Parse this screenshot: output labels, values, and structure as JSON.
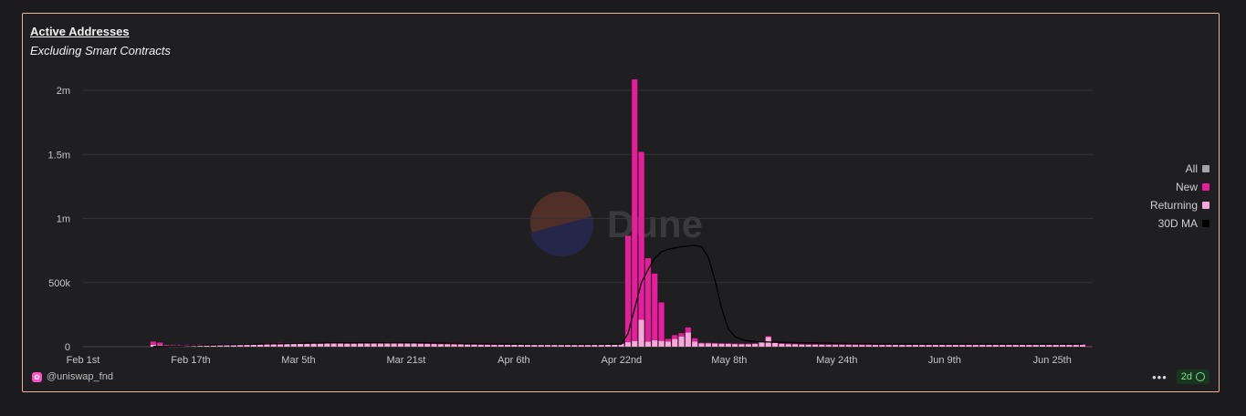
{
  "header": {
    "title": "Active Addresses",
    "subtitle": "Excluding Smart Contracts"
  },
  "watermark": {
    "text": "Dune"
  },
  "footer": {
    "author": "@uniswap_fnd",
    "more_icon": "more-dots-icon",
    "freshness": "2d",
    "freshness_icon": "check-circle-icon"
  },
  "colors": {
    "new": "#e81d9c",
    "returning": "#f7a8d8",
    "all": "#a3a3a3",
    "ma": "#000000",
    "grid": "#343437",
    "axis_text": "#c7c7c7"
  },
  "chart_data": {
    "type": "bar",
    "stacked": true,
    "title": "Active Addresses",
    "subtitle": "Excluding Smart Contracts",
    "x_tick_labels": [
      "Feb 1st",
      "Feb 17th",
      "Mar 5th",
      "Mar 21st",
      "Apr 6th",
      "Apr 22nd",
      "May 8th",
      "May 24th",
      "Jun 9th",
      "Jun 25th"
    ],
    "y_tick_labels": [
      "0",
      "500k",
      "1m",
      "1.5m",
      "2m"
    ],
    "y_ticks": [
      0,
      500000,
      1000000,
      1500000,
      2000000
    ],
    "ylim": [
      0,
      2000000
    ],
    "x_start_day": 0,
    "x_end_day": 150,
    "legend": {
      "position": "right",
      "entries": [
        {
          "name": "All",
          "color": "#a3a3a3"
        },
        {
          "name": "New",
          "color": "#e81d9c"
        },
        {
          "name": "Returning",
          "color": "#f7a8d8"
        },
        {
          "name": "30D MA",
          "color": "#000000"
        }
      ]
    },
    "days_from": "Feb 1st",
    "series": [
      {
        "name": "New",
        "values": [
          0,
          0,
          0,
          0,
          0,
          0,
          0,
          0,
          0,
          0,
          25000,
          20000,
          6000,
          5000,
          4000,
          4000,
          3000,
          3000,
          3000,
          3000,
          3000,
          3000,
          3000,
          3000,
          3000,
          4000,
          3000,
          3000,
          4000,
          6000,
          4000,
          3000,
          4000,
          4000,
          4000,
          4000,
          4000,
          4000,
          4000,
          4000,
          4000,
          4000,
          3000,
          3000,
          4000,
          4000,
          5000,
          6000,
          5000,
          4000,
          4000,
          4000,
          4000,
          3000,
          3000,
          3000,
          3000,
          3000,
          3000,
          2000,
          2000,
          2000,
          2000,
          2000,
          2000,
          2000,
          2000,
          2000,
          2000,
          2000,
          2000,
          2000,
          2000,
          2000,
          2000,
          2000,
          2000,
          2000,
          2000,
          2000,
          2000,
          830000,
          2040000,
          1310000,
          650000,
          520000,
          300000,
          20000,
          30000,
          25000,
          40000,
          25000,
          5000,
          5000,
          5000,
          4000,
          4000,
          3000,
          3000,
          3000,
          3000,
          4000,
          6000,
          8000,
          5000,
          4000,
          4000,
          3000,
          3000,
          3000,
          3000,
          2000,
          2000,
          2000,
          2000,
          2000,
          2000,
          2000,
          2000,
          2000,
          2000,
          2000,
          2000,
          2000,
          2000,
          2000,
          2000,
          2000,
          2000,
          2000,
          2000,
          2000,
          2000,
          2000,
          2000,
          2000,
          2000,
          2000,
          2000,
          2000,
          2000,
          2000,
          2000,
          2000,
          2000,
          2000,
          2000,
          2000,
          2000,
          2000,
          2000
        ]
      },
      {
        "name": "Returning",
        "values": [
          0,
          0,
          0,
          0,
          0,
          0,
          0,
          0,
          0,
          0,
          15000,
          12000,
          8000,
          9000,
          10000,
          11000,
          12000,
          14000,
          14000,
          15000,
          15000,
          16000,
          17000,
          18000,
          19000,
          20000,
          22000,
          24000,
          23000,
          24000,
          25000,
          26000,
          27000,
          26000,
          26000,
          25000,
          25000,
          26000,
          25000,
          24000,
          24000,
          25000,
          26000,
          28000,
          30000,
          32000,
          30000,
          28000,
          27000,
          26000,
          24000,
          22000,
          21000,
          20000,
          19000,
          18000,
          18000,
          17000,
          17000,
          16000,
          16000,
          16000,
          16000,
          16000,
          16000,
          16000,
          16000,
          16000,
          16000,
          16000,
          16000,
          15000,
          15000,
          15000,
          15000,
          15000,
          16000,
          16000,
          17000,
          18000,
          22000,
          35000,
          45000,
          210000,
          40000,
          50000,
          45000,
          40000,
          60000,
          80000,
          110000,
          40000,
          25000,
          25000,
          24000,
          23000,
          22000,
          21000,
          20000,
          20000,
          22000,
          40000,
          75000,
          30000,
          22000,
          20000,
          18000,
          17000,
          16000,
          16000,
          15000,
          15000,
          15000,
          15000,
          15000,
          15000,
          15000,
          15000,
          15000,
          15000,
          15000,
          15000,
          15000,
          15000,
          15000,
          15000,
          15000,
          15000,
          15000,
          15000,
          15000,
          15000,
          15000,
          15000,
          15000,
          15000,
          15000,
          15000,
          15000,
          15000,
          15000,
          15000,
          15000,
          15000,
          15000,
          15000,
          15000,
          15000,
          15000,
          15000
        ]
      },
      {
        "name": "30D MA",
        "values": [
          null,
          null,
          null,
          null,
          null,
          null,
          null,
          null,
          null,
          null,
          1000,
          2000,
          3000,
          4000,
          5000,
          7000,
          9000,
          11000,
          12000,
          13000,
          14000,
          15000,
          16000,
          17000,
          18000,
          19000,
          20000,
          21000,
          22000,
          23000,
          24000,
          25000,
          26000,
          27000,
          28000,
          28000,
          29000,
          29000,
          30000,
          30000,
          30000,
          30000,
          30000,
          30000,
          30000,
          30000,
          30000,
          30000,
          30000,
          30000,
          30000,
          29000,
          28000,
          27000,
          26000,
          25000,
          24000,
          23000,
          22000,
          21000,
          21000,
          20000,
          20000,
          19000,
          19000,
          19000,
          18000,
          18000,
          18000,
          18000,
          18000,
          18000,
          18000,
          18000,
          18000,
          18000,
          18000,
          18000,
          19000,
          19000,
          20000,
          100000,
          300000,
          500000,
          600000,
          690000,
          740000,
          760000,
          770000,
          780000,
          785000,
          790000,
          780000,
          700000,
          520000,
          300000,
          140000,
          80000,
          55000,
          45000,
          40000,
          38000,
          36000,
          35000,
          34000,
          33000,
          32000,
          31000,
          30000,
          29000,
          28000,
          27000,
          26000,
          25000,
          24000,
          23000,
          22000,
          21000,
          20000,
          20000,
          20000,
          20000,
          19000,
          19000,
          19000,
          19000,
          19000,
          19000,
          19000,
          19000,
          19000,
          19000,
          19000,
          19000,
          19000,
          19000,
          19000,
          19000,
          19000,
          19000,
          19000,
          19000,
          19000,
          19000,
          19000,
          19000,
          19000,
          19000,
          19000,
          19000
        ]
      }
    ]
  }
}
